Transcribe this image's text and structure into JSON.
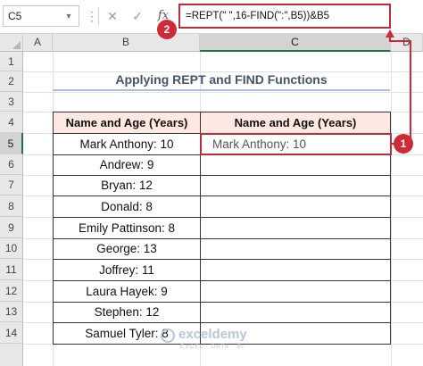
{
  "formula_bar": {
    "name_box": "C5",
    "more_icon": "⋮",
    "cancel_icon": "✕",
    "enter_icon": "✓",
    "fx": "fx",
    "formula": "=REPT(\" \",16-FIND(\":\",B5))&B5"
  },
  "columns": [
    "A",
    "B",
    "C",
    "D"
  ],
  "rows": [
    "1",
    "2",
    "3",
    "4",
    "5",
    "6",
    "7",
    "8",
    "9",
    "10",
    "11",
    "12",
    "13",
    "14"
  ],
  "title": "Applying REPT and FIND Functions",
  "table": {
    "header_b": "Name and Age (Years)",
    "header_c": "Name and Age (Years)",
    "names": [
      "Mark Anthony: 10",
      "Andrew: 9",
      "Bryan: 12",
      "Donald: 8",
      "Emily Pattinson: 8",
      "George: 13",
      "Joffrey: 11",
      "Laura Hayek: 9",
      "Stephen: 12",
      "Samuel Tyler: 8"
    ],
    "result_c5": "Mark Anthony: 10"
  },
  "annotations": {
    "badge1": "1",
    "badge2": "2"
  },
  "colors": {
    "accent_red": "#cf2a36",
    "header_fill": "#fde9e1",
    "title_underline": "#a9bfe0"
  },
  "watermark": {
    "name": "exceldemy",
    "tagline": "EXCEL · DATA · BI"
  }
}
